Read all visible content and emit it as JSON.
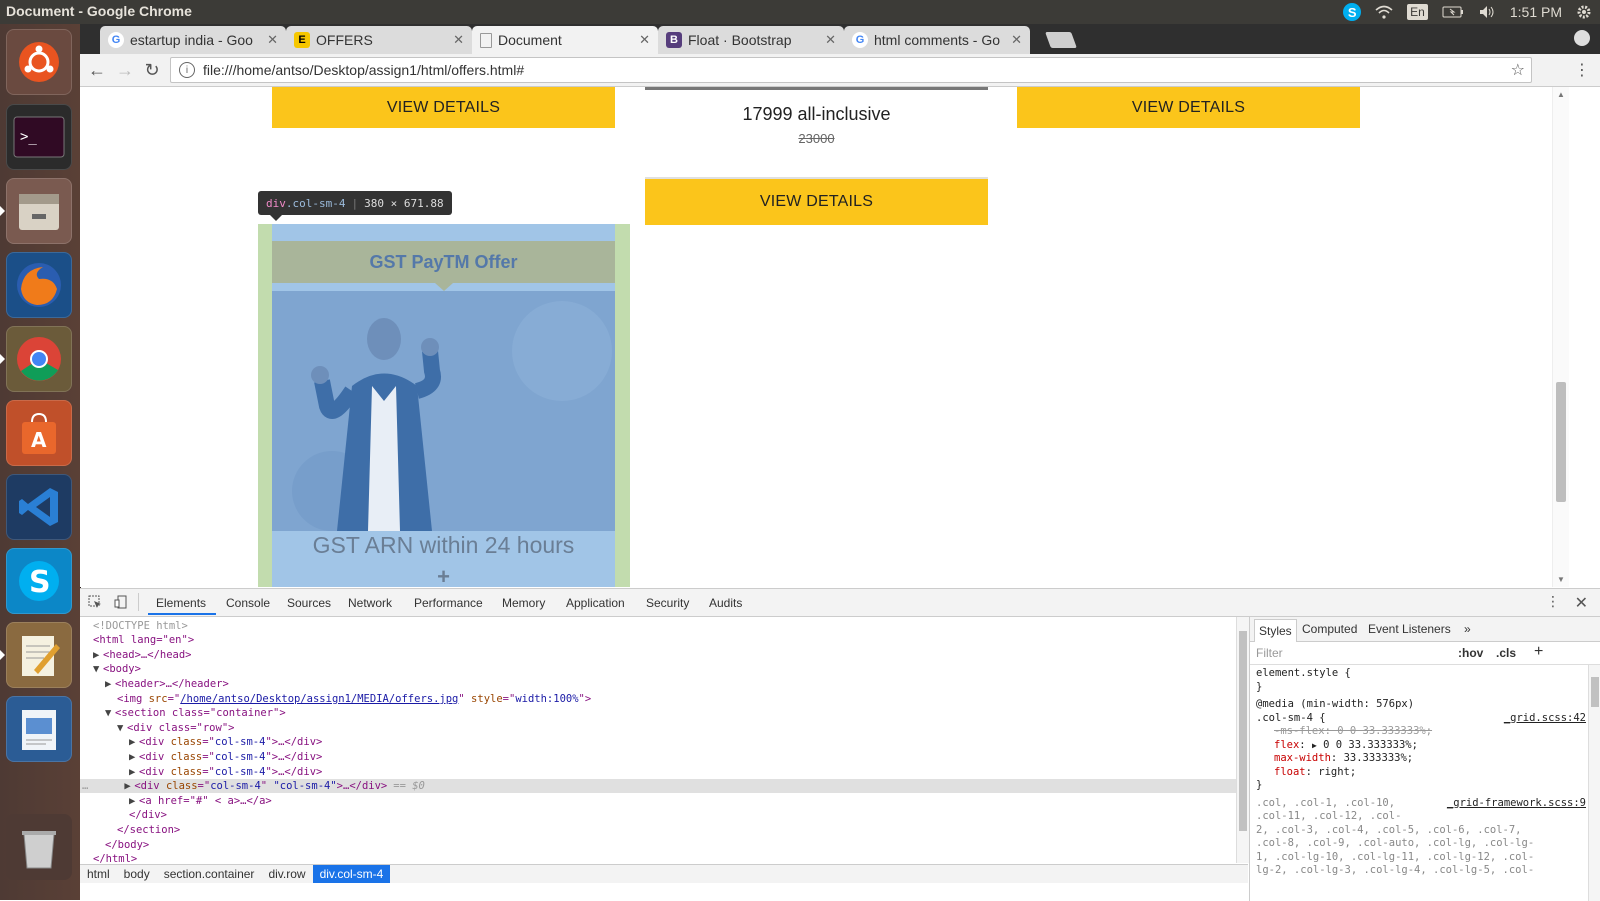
{
  "os": {
    "window_title": "Document - Google Chrome",
    "language": "En",
    "clock": "1:51 PM"
  },
  "tabs": [
    {
      "title": "estartup india - Goo",
      "favicon": "G"
    },
    {
      "title": "OFFERS",
      "favicon": "E"
    },
    {
      "title": "Document",
      "favicon": "doc"
    },
    {
      "title": "Float · Bootstrap",
      "favicon": "B"
    },
    {
      "title": "html comments - Go",
      "favicon": "G"
    }
  ],
  "address_bar": {
    "url": "file:///home/antso/Desktop/assign1/html/offers.html#"
  },
  "page": {
    "btn_left": "VIEW DETAILS",
    "btn_right": "VIEW DETAILS",
    "btn_middle": "VIEW DETAILS",
    "price": "17999 all-inclusive",
    "old_price": "23000",
    "offer_title": "GST PayTM Offer",
    "offer_caption": "GST ARN within 24 hours",
    "offer_plus": "+",
    "inspect_tag": "div",
    "inspect_class": ".col-sm-4",
    "inspect_size": "380 × 671.88"
  },
  "devtools": {
    "tabs": [
      "Elements",
      "Console",
      "Sources",
      "Network",
      "Performance",
      "Memory",
      "Application",
      "Security",
      "Audits"
    ],
    "dom": {
      "doctype": "<!DOCTYPE html>",
      "html_open": "<html lang=\"en\">",
      "head": "<head>…</head>",
      "body_open": "<body>",
      "header": "<header>…</header>",
      "img_src": "/home/antso/Desktop/assign1/MEDIA/offers.jpg",
      "img_style": "width:100%",
      "section_open": "<section class=\"container\">",
      "row_open": "<div class=\"row\">",
      "col_class": "col-sm-4",
      "selected_suffix": "== $0",
      "anchor": "<a href=\"#\" < a>…</a>",
      "div_close": "</div>",
      "section_close": "</section>",
      "body_close": "</body>",
      "html_close": "</html>"
    },
    "breadcrumbs": [
      "html",
      "body",
      "section.container",
      "div.row",
      "div.col-sm-4"
    ],
    "styles_tabs": [
      "Styles",
      "Computed",
      "Event Listeners"
    ],
    "filter_placeholder": "Filter",
    "hov": ":hov",
    "cls": ".cls",
    "styles": {
      "element_style": "element.style {",
      "close_brace": "}",
      "media": "@media (min-width: 576px)",
      "selector": ".col-sm-4 {",
      "source1": "_grid.scss:42",
      "ms_flex": "-ms-flex: 0 0 33.333333%;",
      "flex": "0 0 33.333333%;",
      "max_width": "33.333333%;",
      "float": "right;",
      "source2": "_grid-framework.scss:9",
      "grid_selectors": [
        ".col, .col-1, .col-10,",
        ".col-11, .col-12, .col-",
        "2, .col-3, .col-4, .col-5, .col-6, .col-7,",
        ".col-8, .col-9, .col-auto, .col-lg, .col-lg-",
        "1, .col-lg-10, .col-lg-11, .col-lg-12, .col-",
        "lg-2, .col-lg-3, .col-lg-4, .col-lg-5, .col-"
      ]
    }
  }
}
